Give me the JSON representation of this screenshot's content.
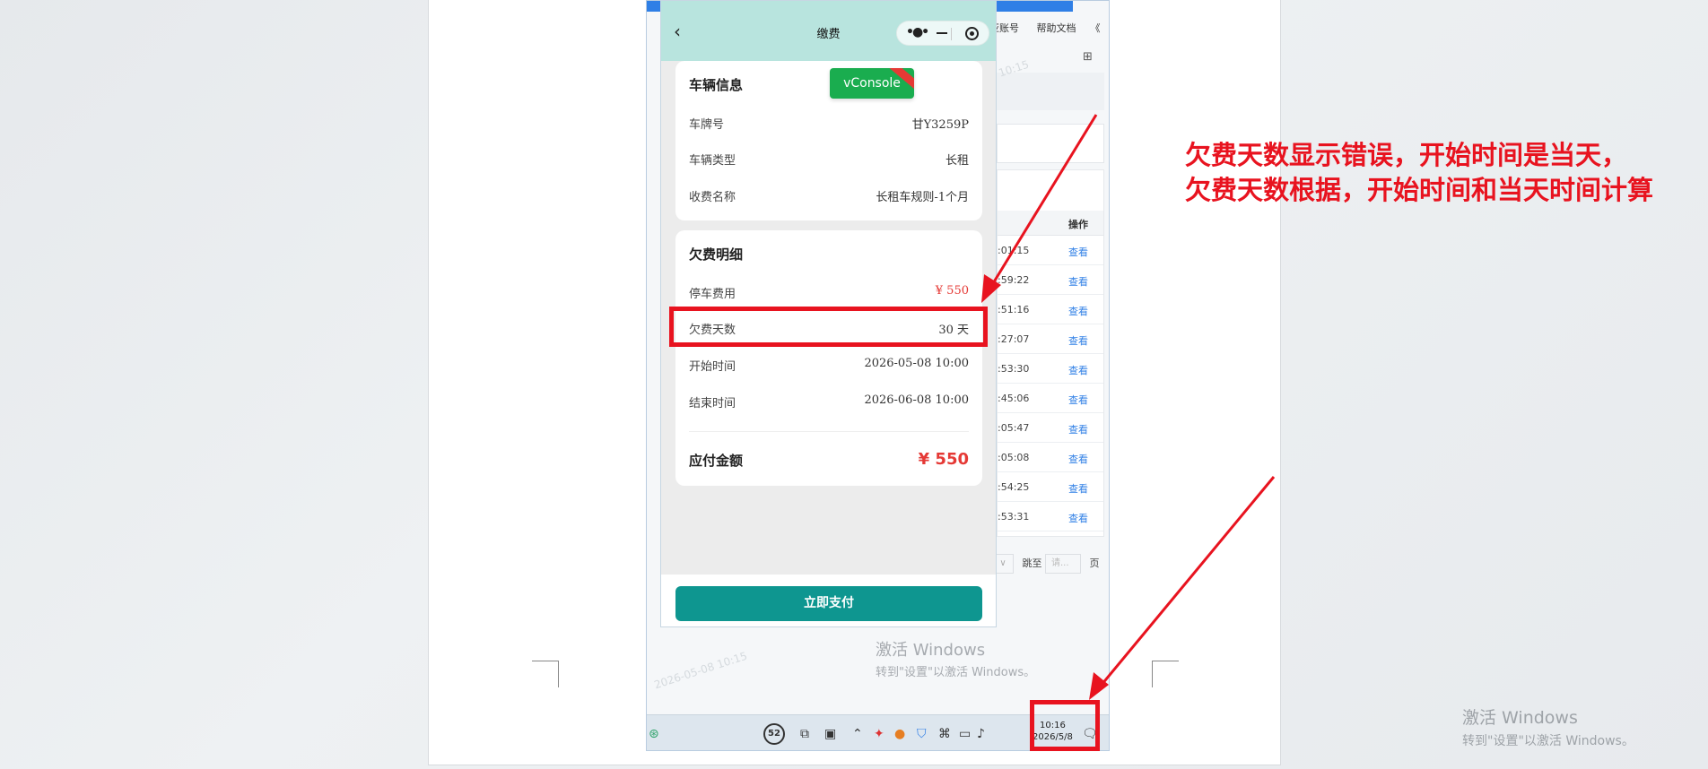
{
  "background": {
    "header_items": [
      "亚账号",
      "帮助文档"
    ],
    "header_chevron": "《",
    "table_header_action": "操作",
    "rows": [
      {
        "time": ":01:15",
        "action": "查看"
      },
      {
        "time": ":59:22",
        "action": "查看"
      },
      {
        "time": ":51:16",
        "action": "查看"
      },
      {
        "time": ":27:07",
        "action": "查看"
      },
      {
        "time": ":53:30",
        "action": "查看"
      },
      {
        "time": ":45:06",
        "action": "查看"
      },
      {
        "time": ":05:47",
        "action": "查看"
      },
      {
        "time": ":05:08",
        "action": "查看"
      },
      {
        "time": ":54:25",
        "action": "查看"
      },
      {
        "time": ":53:31",
        "action": "查看"
      }
    ],
    "pager": {
      "jump_label": "跳至",
      "input_placeholder": "请...",
      "page_label": "页"
    },
    "watermark_title": "激活 Windows",
    "watermark_sub": "转到\"设置\"以激活 Windows。",
    "faint_stamp": "2026-05-08 10:15"
  },
  "taskbar": {
    "badge": "52",
    "clock_time": "10:16",
    "clock_date": "2026/5/8"
  },
  "miniapp": {
    "nav_title": "缴费",
    "vconsole_label": "vConsole",
    "vehicle_card": {
      "title": "车辆信息",
      "rows": [
        {
          "label": "车牌号",
          "value": "甘Y3259P"
        },
        {
          "label": "车辆类型",
          "value": "长租"
        },
        {
          "label": "收费名称",
          "value": "长租车规则-1个月"
        }
      ]
    },
    "arrears_card": {
      "title": "欠费明细",
      "parking_fee": {
        "label": "停车费用",
        "value": "¥ 550"
      },
      "days": {
        "label": "欠费天数",
        "value": "30 天"
      },
      "start": {
        "label": "开始时间",
        "value": "2026-05-08 10:00"
      },
      "end": {
        "label": "结束时间",
        "value": "2026-06-08 10:00"
      },
      "total": {
        "label": "应付金额",
        "value": "¥ 550"
      }
    },
    "pay_button": "立即支付"
  },
  "annotation": {
    "line1": "欠费天数显示错误，开始时间是当天，",
    "line2": "欠费天数根据，开始时间和当天时间计算"
  },
  "os_watermark": {
    "title": "激活 Windows",
    "sub": "转到\"设置\"以激活 Windows。"
  },
  "colors": {
    "annotation_red": "#e8131f",
    "nav_mint": "#b8e4de",
    "pay_teal": "#0e9690",
    "vconsole_green": "#1aad4f",
    "link_blue": "#2f7fe6"
  }
}
